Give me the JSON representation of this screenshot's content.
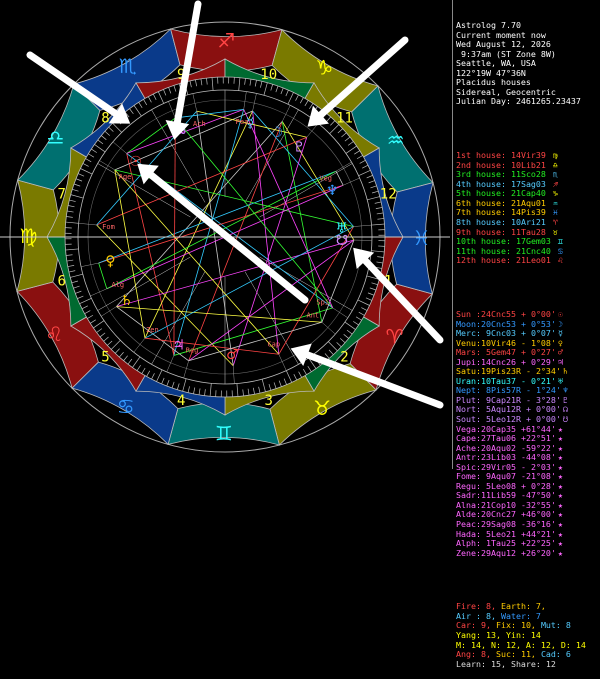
{
  "window": {
    "app_title": "Astrolog 7.70"
  },
  "info": {
    "lines": [
      "Astrolog 7.70",
      "Current moment now",
      "Wed August 12, 2026",
      " 9:37am (ST Zone 8W)",
      "Seattle, WA, USA",
      "122°19W 47°36N",
      "Placidus houses",
      "Sidereal, Geocentric",
      "Julian Day: 2461265.23437"
    ]
  },
  "houses": [
    {
      "label": "1st house:",
      "value": "14Vir39",
      "color": "#ff4444",
      "sign_color": "#ffff00",
      "glyph": "♍"
    },
    {
      "label": "2nd house:",
      "value": "10Lib21",
      "color": "#ff4444",
      "sign_color": "#ffff00",
      "glyph": "♎"
    },
    {
      "label": "3rd house:",
      "value": "11Sco28",
      "color": "#22ee22",
      "sign_color": "#55ccff",
      "glyph": "♏"
    },
    {
      "label": "4th house:",
      "value": "17Sag03",
      "color": "#55ccff",
      "sign_color": "#ff4444",
      "glyph": "♐"
    },
    {
      "label": "5th house:",
      "value": "21Cap40",
      "color": "#22ee22",
      "sign_color": "#ffff00",
      "glyph": "♑"
    },
    {
      "label": "6th house:",
      "value": "21Aqu01",
      "color": "#ffcc00",
      "sign_color": "#33ffff",
      "glyph": "♒"
    },
    {
      "label": "7th house:",
      "value": "14Pis39",
      "color": "#ffcc00",
      "sign_color": "#3399ff",
      "glyph": "♓"
    },
    {
      "label": "8th house:",
      "value": "10Ari21",
      "color": "#55ccff",
      "sign_color": "#ff4444",
      "glyph": "♈"
    },
    {
      "label": "9th house:",
      "value": "11Tau28",
      "color": "#ff4444",
      "sign_color": "#ffff00",
      "glyph": "♉"
    },
    {
      "label": "10th house:",
      "value": "17Gem03",
      "color": "#22ee22",
      "sign_color": "#33ffff",
      "glyph": "♊"
    },
    {
      "label": "11th house:",
      "value": "21Cnc40",
      "color": "#22ee22",
      "sign_color": "#3399ff",
      "glyph": "♋"
    },
    {
      "label": "12th house:",
      "value": "21Leo01",
      "color": "#ff4444",
      "sign_color": "#ff4444",
      "glyph": "♌"
    }
  ],
  "planets": [
    {
      "label": "Sun :",
      "pos": "24Cnc55",
      "lat": "+ 0°00'",
      "color": "#ff4444",
      "glyph": "☉"
    },
    {
      "label": "Moon:",
      "pos": "20Cnc53",
      "lat": "+ 0°53'",
      "color": "#3399ff",
      "glyph": "☽"
    },
    {
      "label": "Merc:",
      "pos": " 9Cnc03",
      "lat": "+ 0°07'",
      "color": "#55ccff",
      "glyph": "☿"
    },
    {
      "label": "Venu:",
      "pos": "10Vir46",
      "lat": "- 1°08'",
      "color": "#ffcc00",
      "glyph": "♀"
    },
    {
      "label": "Mars:",
      "pos": " 5Gem47",
      "lat": "+ 0°27'",
      "color": "#ff4444",
      "glyph": "♂"
    },
    {
      "label": "Jupi:",
      "pos": "14Cnc26",
      "lat": "+ 0°29'",
      "color": "#ff66ff",
      "glyph": "♃"
    },
    {
      "label": "Satu:",
      "pos": "19Pis23R",
      "lat": "- 2°34'",
      "color": "#ffcc00",
      "glyph": "♄"
    },
    {
      "label": "Uran:",
      "pos": "10Tau37",
      "lat": "- 0°21'",
      "color": "#33ffff",
      "glyph": "♅"
    },
    {
      "label": "Nept:",
      "pos": " 8Pis57R",
      "lat": "- 1°24'",
      "color": "#3399ff",
      "glyph": "♆"
    },
    {
      "label": "Plut:",
      "pos": " 9Cap21R",
      "lat": "- 3°28'",
      "color": "#cc88ff",
      "glyph": "♇"
    },
    {
      "label": "Nort:",
      "pos": " 5Aqu12R",
      "lat": "+ 0°00'",
      "color": "#cc88ff",
      "glyph": "☊"
    },
    {
      "label": "Sout:",
      "pos": " 5Leo12R",
      "lat": "+ 0°00'",
      "color": "#cc88ff",
      "glyph": "☋"
    },
    {
      "label": "Vega:",
      "pos": "20Cap35",
      "lat": "+61°44'",
      "color": "#ff66ff",
      "glyph": "★"
    },
    {
      "label": "Cape:",
      "pos": "27Tau06",
      "lat": "+22°51'",
      "color": "#ff66ff",
      "glyph": "★"
    },
    {
      "label": "Ache:",
      "pos": "20Aqu02",
      "lat": "-59°22'",
      "color": "#ff66ff",
      "glyph": "★"
    },
    {
      "label": "Antr:",
      "pos": "23Lib03",
      "lat": "-44°08'",
      "color": "#ff66ff",
      "glyph": "★"
    },
    {
      "label": "Spic:",
      "pos": "29Vir05",
      "lat": "- 2°03'",
      "color": "#ff66ff",
      "glyph": "★"
    },
    {
      "label": "Fome:",
      "pos": " 9Aqu07",
      "lat": "-21°08'",
      "color": "#ff66ff",
      "glyph": "★"
    },
    {
      "label": "Regu:",
      "pos": " 5Leo08",
      "lat": "+ 0°28'",
      "color": "#ff66ff",
      "glyph": "★"
    },
    {
      "label": "Sadr:",
      "pos": "11Lib59",
      "lat": "-47°50'",
      "color": "#ff66ff",
      "glyph": "★"
    },
    {
      "label": "Alna:",
      "pos": "21Cop10",
      "lat": "-32°55'",
      "color": "#ff66ff",
      "glyph": "★"
    },
    {
      "label": "Alde:",
      "pos": "20Cnc27",
      "lat": "+46°00'",
      "color": "#ff66ff",
      "glyph": "★"
    },
    {
      "label": "Peac:",
      "pos": "29Sag08",
      "lat": "-36°16'",
      "color": "#ff66ff",
      "glyph": "★"
    },
    {
      "label": "Hada:",
      "pos": " 5Leo21",
      "lat": "+44°21'",
      "color": "#ff66ff",
      "glyph": "★"
    },
    {
      "label": "Alph:",
      "pos": " 1Tau25",
      "lat": "+22°25'",
      "color": "#ff66ff",
      "glyph": "★"
    },
    {
      "label": "Zene:",
      "pos": "29Aqu12",
      "lat": "+26°20'",
      "color": "#ff66ff",
      "glyph": "★"
    }
  ],
  "summary": [
    {
      "segments": [
        [
          "Fire: 8, ",
          "#ff4444"
        ],
        [
          "Earth: 7,",
          "#ffcc00"
        ]
      ]
    },
    {
      "segments": [
        [
          "Air : 8, ",
          "#55ccff"
        ],
        [
          "Water: 7",
          "#3399ff"
        ]
      ]
    },
    {
      "segments": [
        [
          "Car: 9, ",
          "#ff4444"
        ],
        [
          "Fix: 10, ",
          "#ffcc00"
        ],
        [
          "Mut: 8",
          "#55ccff"
        ]
      ]
    },
    {
      "segments": [
        [
          "Yang: 13, Yin: 14",
          "#ffff00"
        ]
      ]
    },
    {
      "segments": [
        [
          "M: 14, N: 12, A: 12, D: 14",
          "#ffff00"
        ]
      ]
    },
    {
      "segments": [
        [
          "Ang: 8, ",
          "#ff4444"
        ],
        [
          "Suc: 11, ",
          "#ffcc00"
        ],
        [
          "Cad: 6",
          "#55ccff"
        ]
      ]
    },
    {
      "segments": [
        [
          "Learn: 15, Share: 12",
          "#dddddd"
        ]
      ]
    }
  ],
  "wheel": {
    "signs": [
      {
        "glyph": "♈",
        "color": "#ff4444"
      },
      {
        "glyph": "♉",
        "color": "#ffff00"
      },
      {
        "glyph": "♊",
        "color": "#33ffff"
      },
      {
        "glyph": "♋",
        "color": "#3399ff"
      },
      {
        "glyph": "♌",
        "color": "#ff4444"
      },
      {
        "glyph": "♍",
        "color": "#ffff00"
      },
      {
        "glyph": "♎",
        "color": "#33ffff"
      },
      {
        "glyph": "♏",
        "color": "#3399ff"
      },
      {
        "glyph": "♐",
        "color": "#ff4444"
      },
      {
        "glyph": "♑",
        "color": "#ffff00"
      },
      {
        "glyph": "♒",
        "color": "#33ffff"
      },
      {
        "glyph": "♓",
        "color": "#3399ff"
      }
    ],
    "house_numbers": [
      "1",
      "2",
      "3",
      "4",
      "5",
      "6",
      "7",
      "8",
      "9",
      "10",
      "11",
      "12"
    ],
    "planet_marks": [
      {
        "glyph": "☉",
        "color": "#ff4444",
        "label": ""
      },
      {
        "glyph": "☽",
        "color": "#3399ff",
        "label": ""
      },
      {
        "glyph": "☿",
        "color": "#55ccff",
        "label": ""
      },
      {
        "glyph": "♀",
        "color": "#ffcc00",
        "label": ""
      },
      {
        "glyph": "♂",
        "color": "#ff4444",
        "label": ""
      },
      {
        "glyph": "♃",
        "color": "#ff66ff",
        "label": ""
      },
      {
        "glyph": "♄",
        "color": "#ffcc00",
        "label": ""
      },
      {
        "glyph": "♅",
        "color": "#33ffff",
        "label": ""
      },
      {
        "glyph": "♆",
        "color": "#3399ff",
        "label": ""
      },
      {
        "glyph": "♇",
        "color": "#cc88ff",
        "label": ""
      },
      {
        "glyph": "☊",
        "color": "#cc88ff",
        "label": ""
      },
      {
        "glyph": "☋",
        "color": "#cc88ff",
        "label": ""
      },
      {
        "glyph": "",
        "color": "#ff6666",
        "label": "Cap"
      },
      {
        "glyph": "",
        "color": "#ff6666",
        "label": "Alg"
      },
      {
        "glyph": "",
        "color": "#ff6666",
        "label": "Ach"
      },
      {
        "glyph": "",
        "color": "#ff6666",
        "label": "Spi"
      },
      {
        "glyph": "",
        "color": "#ff6666",
        "label": "Reg"
      },
      {
        "glyph": "",
        "color": "#ff6666",
        "label": "Age"
      },
      {
        "glyph": "",
        "color": "#ff6666",
        "label": "Veg"
      },
      {
        "glyph": "",
        "color": "#ff6666",
        "label": "Fom"
      },
      {
        "glyph": "",
        "color": "#ff6666",
        "label": "Pea"
      },
      {
        "glyph": "",
        "color": "#ff6666",
        "label": "Ant"
      },
      {
        "glyph": "",
        "color": "#ff6666",
        "label": "Zen"
      }
    ],
    "aspect_colors": [
      "#ff4444",
      "#33ff33",
      "#33ccff",
      "#ff44ff",
      "#cccccc",
      "#ffff44"
    ]
  }
}
